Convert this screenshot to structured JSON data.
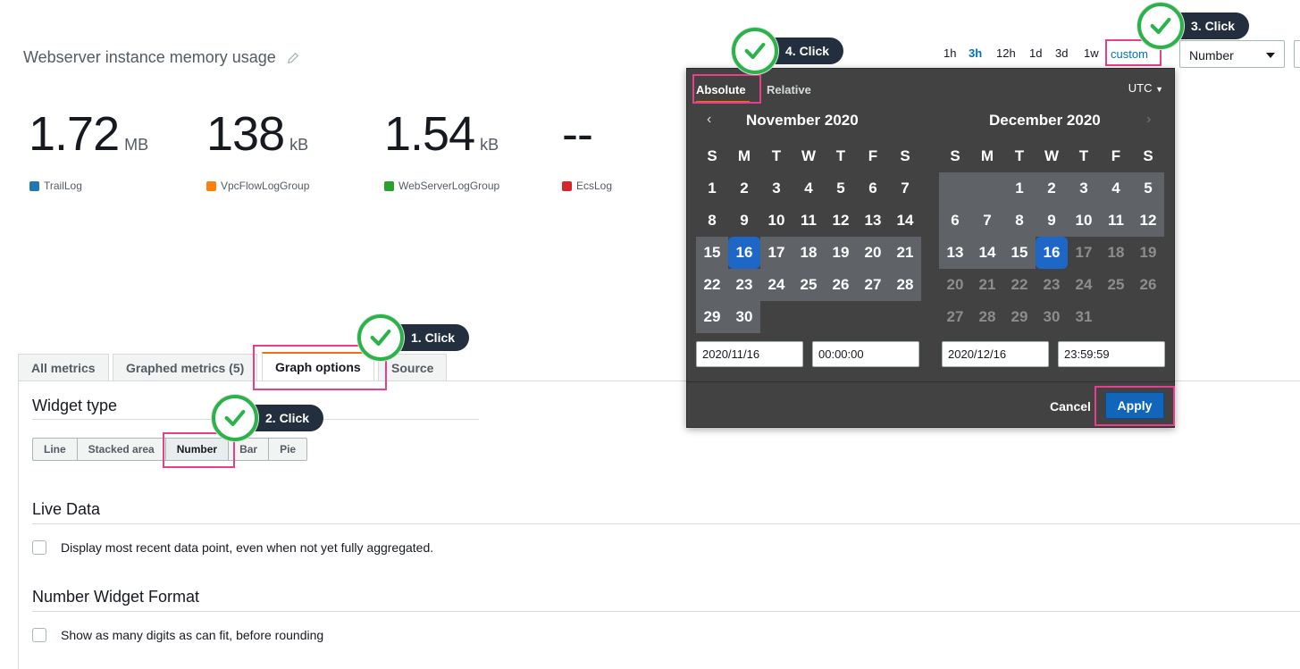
{
  "widget": {
    "title": "Webserver instance memory usage"
  },
  "metrics": [
    {
      "value": "1.72",
      "unit": "MB",
      "legend": "TrailLog",
      "color": "#1f77b4"
    },
    {
      "value": "138",
      "unit": "kB",
      "legend": "VpcFlowLogGroup",
      "color": "#ff7f0e"
    },
    {
      "value": "1.54",
      "unit": "kB",
      "legend": "WebServerLogGroup",
      "color": "#2ca02c"
    },
    {
      "value": "--",
      "unit": "",
      "legend": "EcsLog",
      "color": "#d62728"
    }
  ],
  "time_range": {
    "options": [
      "1h",
      "3h",
      "12h",
      "1d",
      "3d",
      "1w"
    ],
    "active": "3h",
    "custom_label": "custom"
  },
  "view_select": {
    "value": "Number"
  },
  "tabs": [
    "All metrics",
    "Graphed metrics (5)",
    "Graph options",
    "Source"
  ],
  "widget_type": {
    "heading": "Widget type",
    "options": [
      "Line",
      "Stacked area",
      "Number",
      "Bar",
      "Pie"
    ],
    "selected": "Number"
  },
  "live_data": {
    "heading": "Live Data",
    "checkbox_label": "Display most recent data point, even when not yet fully aggregated."
  },
  "number_format": {
    "heading": "Number Widget Format",
    "checkbox_label": "Show as many digits as can fit, before rounding"
  },
  "date_picker": {
    "tab_absolute": "Absolute",
    "tab_relative": "Relative",
    "timezone": "UTC",
    "left_month": "November  2020",
    "right_month": "December  2020",
    "weekdays": [
      "S",
      "M",
      "T",
      "W",
      "T",
      "F",
      "S"
    ],
    "start_date": "2020/11/16",
    "start_time": "00:00:00",
    "end_date": "2020/12/16",
    "end_time": "23:59:59",
    "cancel": "Cancel",
    "apply": "Apply"
  },
  "callouts": {
    "c1": "1. Click",
    "c2": "2. Click",
    "c3": "3. Click",
    "c4": "4. Click"
  },
  "colors": {
    "accent": "#0073bb",
    "highlight": "#e83e8c",
    "check": "#29b34a",
    "selected_day": "#1f67c7",
    "apply": "#1166bb"
  }
}
